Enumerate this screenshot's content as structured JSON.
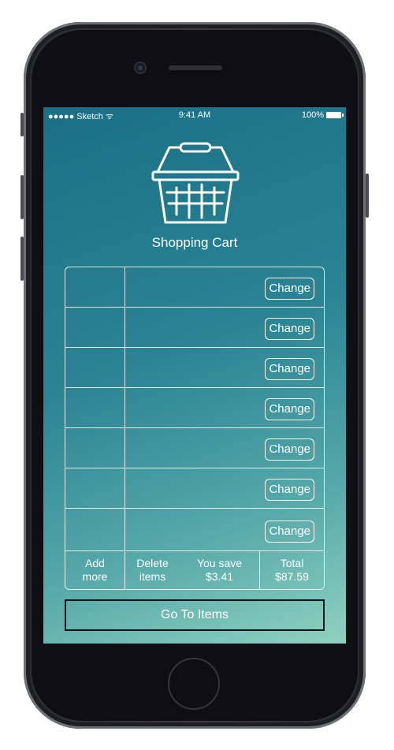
{
  "status_bar": {
    "carrier": "●●●●● Sketch ᯤ",
    "time": "9:41 AM",
    "battery": "100%"
  },
  "header": {
    "icon": "shopping-basket-icon",
    "title": "Shopping Cart"
  },
  "cart": {
    "rows": [
      {
        "change_label": "Change"
      },
      {
        "change_label": "Change"
      },
      {
        "change_label": "Change"
      },
      {
        "change_label": "Change"
      },
      {
        "change_label": "Change"
      },
      {
        "change_label": "Change"
      },
      {
        "change_label": "Change"
      }
    ],
    "footer": {
      "add_more": [
        "Add",
        "more"
      ],
      "delete_items": [
        "Delete",
        "items"
      ],
      "you_save": [
        "You save",
        "$3.41"
      ],
      "total": [
        "Total",
        "$87.59"
      ]
    }
  },
  "actions": {
    "go_to_items": "Go To Items"
  },
  "colors": {
    "gradient_start": "#1a6f86",
    "gradient_end": "#8fd1c0",
    "text": "#ffffff",
    "phone_body": "#2b2c31"
  }
}
